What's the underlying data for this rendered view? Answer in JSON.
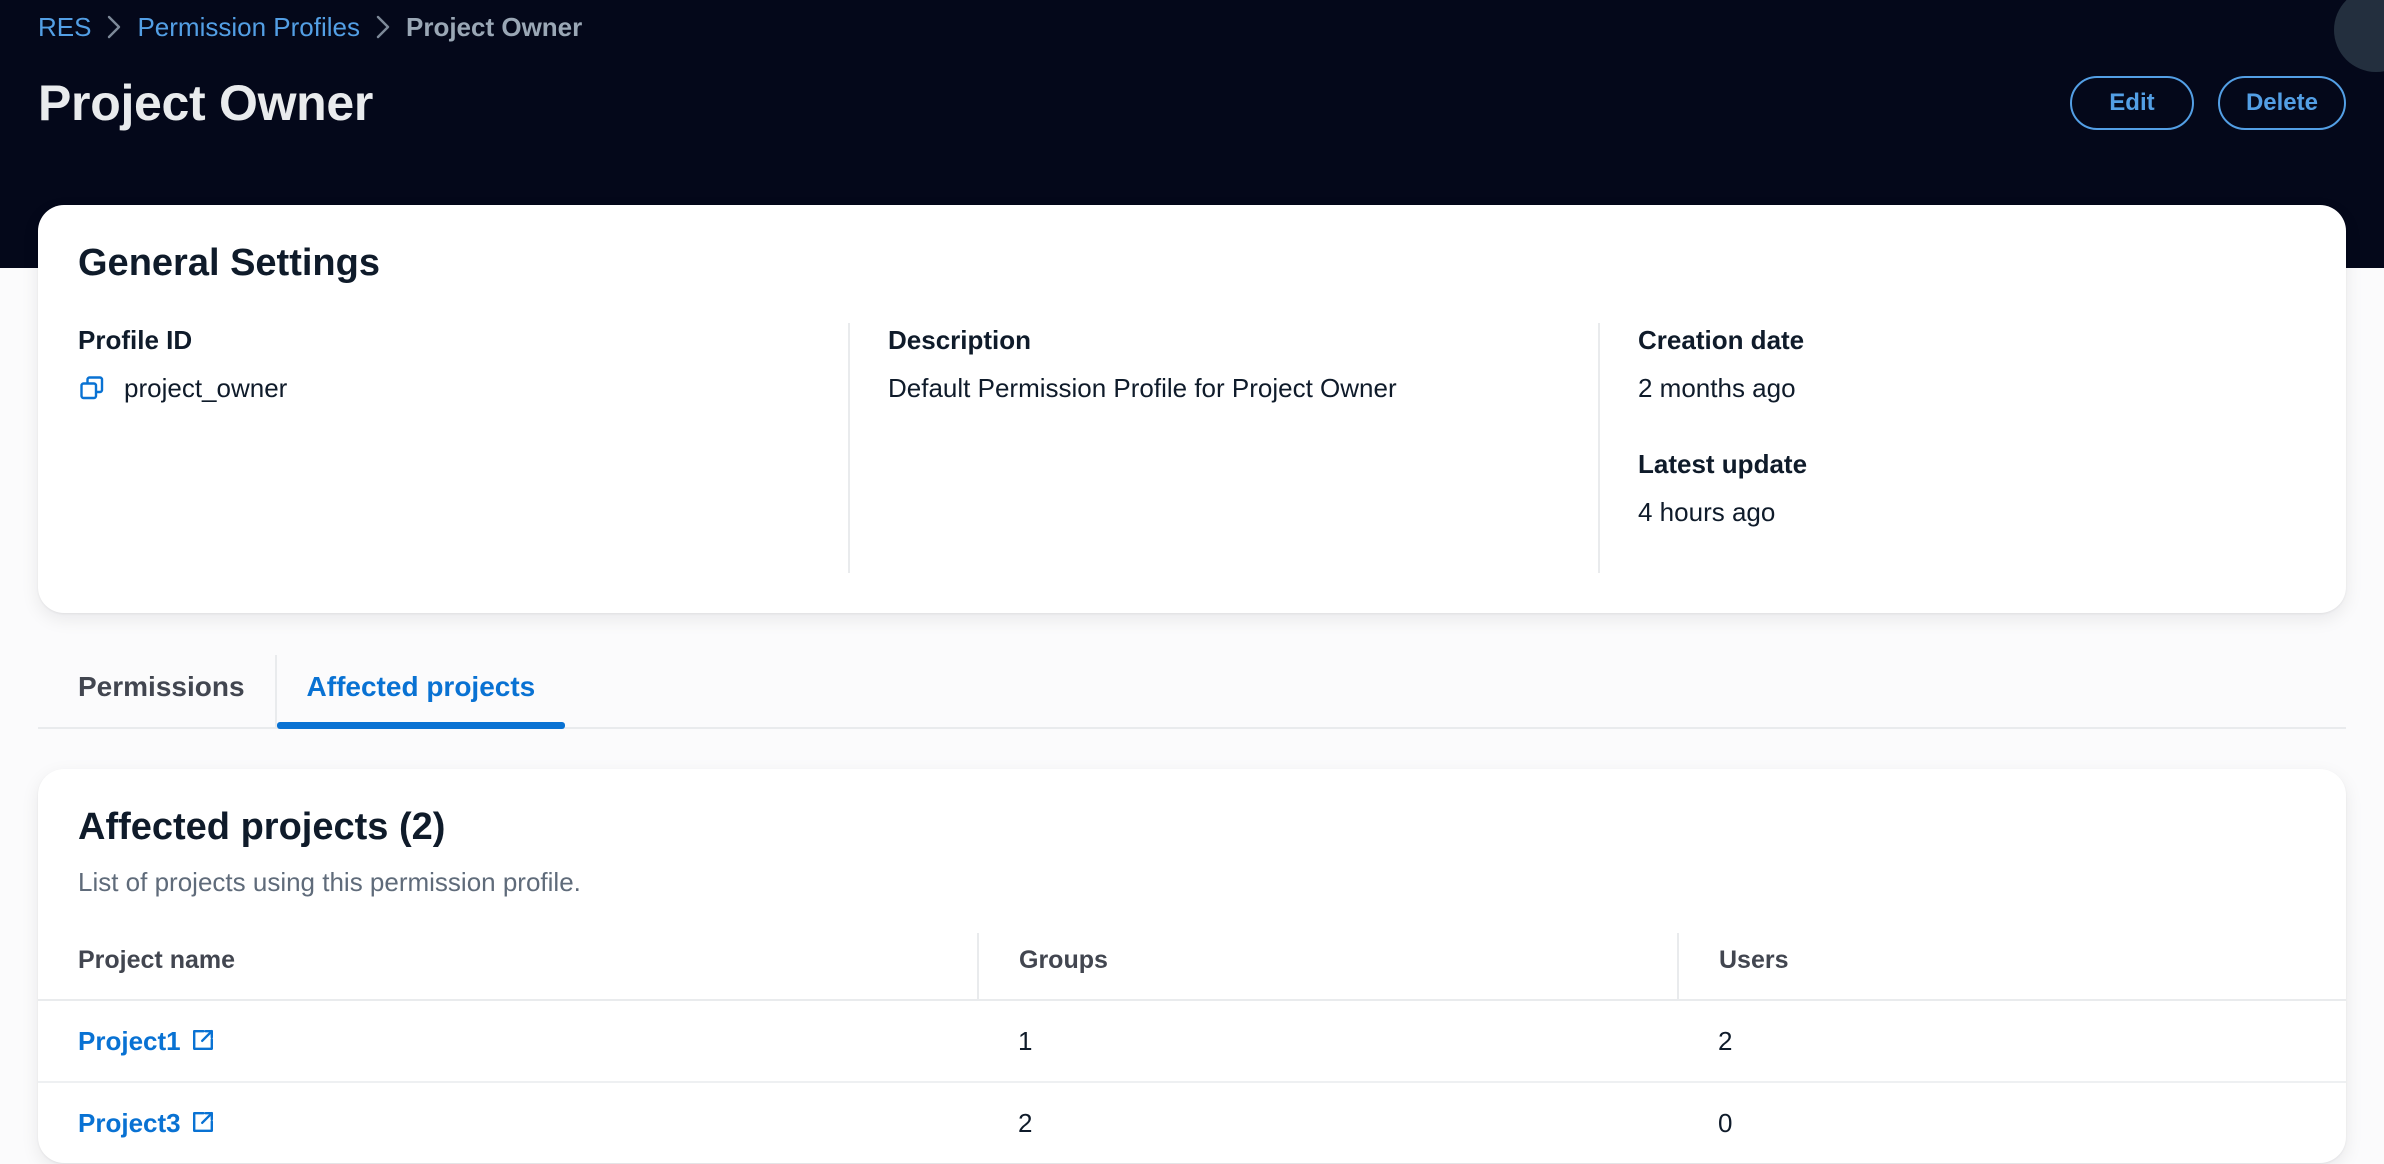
{
  "header": {
    "breadcrumb": [
      {
        "label": "RES",
        "current": false
      },
      {
        "label": "Permission Profiles",
        "current": false
      },
      {
        "label": "Project Owner",
        "current": true
      }
    ],
    "title": "Project Owner",
    "actions": {
      "edit_label": "Edit",
      "delete_label": "Delete"
    },
    "background_color": "#04081a",
    "link_color": "#539fe5"
  },
  "general_settings": {
    "title": "General Settings",
    "profile_id": {
      "label": "Profile ID",
      "value": "project_owner",
      "copy_icon": "copy-icon"
    },
    "description": {
      "label": "Description",
      "value": "Default Permission Profile for Project Owner"
    },
    "creation_date": {
      "label": "Creation date",
      "value": "2 months ago"
    },
    "latest_update": {
      "label": "Latest update",
      "value": "4 hours ago"
    }
  },
  "tabs": [
    {
      "label": "Permissions",
      "active": false
    },
    {
      "label": "Affected projects",
      "active": true
    }
  ],
  "affected_projects": {
    "title": "Affected projects (2)",
    "subtitle": "List of projects using this permission profile.",
    "columns": [
      "Project name",
      "Groups",
      "Users"
    ],
    "rows": [
      {
        "project_name": "Project1",
        "groups": "1",
        "users": "2"
      },
      {
        "project_name": "Project3",
        "groups": "2",
        "users": "0"
      }
    ]
  },
  "theme": {
    "accent": "#0972d3",
    "dark_bg": "#04081a",
    "page_bg": "#fbfbfc",
    "card_bg": "#ffffff",
    "border": "#e9ebed",
    "muted_text": "#5f6b7a"
  }
}
